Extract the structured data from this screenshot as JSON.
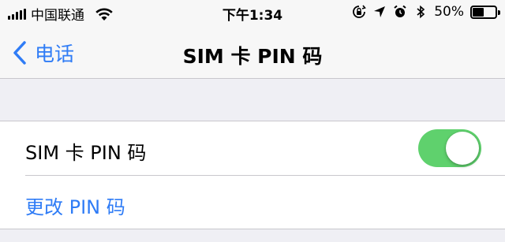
{
  "status_bar": {
    "carrier": "中国联通",
    "time": "下午1:34",
    "battery_percent": "50%",
    "battery_level": 0.5,
    "icons": [
      "signal-icon",
      "wifi-icon",
      "orientation-lock-icon",
      "location-icon",
      "alarm-icon",
      "bluetooth-icon",
      "battery-icon"
    ]
  },
  "nav": {
    "back_label": "电话",
    "title": "SIM 卡 PIN 码"
  },
  "settings": {
    "sim_pin_label": "SIM 卡 PIN 码",
    "sim_pin_enabled": true,
    "change_pin_label": "更改 PIN 码"
  },
  "colors": {
    "accent": "#2f7cf6",
    "toggle_on": "#5fd16d",
    "background": "#efeff4"
  }
}
